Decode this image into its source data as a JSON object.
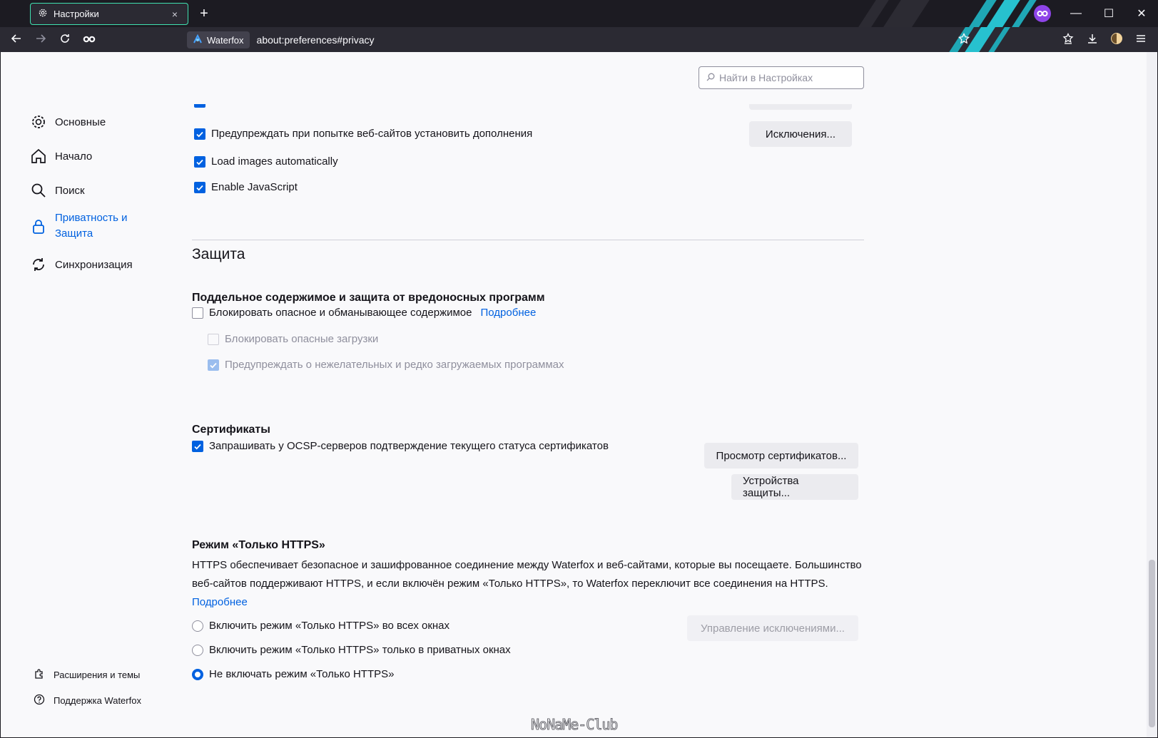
{
  "window": {
    "tab_title": "Настройки",
    "close_tab_symbol": "×",
    "new_tab_symbol": "+",
    "minimize_symbol": "—",
    "maximize_symbol": "☐",
    "close_symbol": "✕",
    "accent_color": "#3fe1b0"
  },
  "navbar": {
    "identity_label": "Waterfox",
    "url": "about:preferences#privacy"
  },
  "search": {
    "placeholder": "Найти в Настройках"
  },
  "sidebar": {
    "items": [
      {
        "label": "Основные",
        "icon": "gear-icon"
      },
      {
        "label": "Начало",
        "icon": "home-icon"
      },
      {
        "label": "Поиск",
        "icon": "search-icon"
      },
      {
        "label": "Приватность и Защита",
        "icon": "lock-icon",
        "selected": true
      },
      {
        "label": "Синхронизация",
        "icon": "sync-icon"
      }
    ],
    "footer": [
      {
        "label": "Расширения и темы",
        "icon": "puzzle-icon"
      },
      {
        "label": "Поддержка Waterfox",
        "icon": "help-icon"
      }
    ]
  },
  "permissions": {
    "warn_addons": "Предупреждать при попытке веб-сайтов установить дополнения",
    "exceptions_button": "Исключения...",
    "load_images": "Load images automatically",
    "enable_js": "Enable JavaScript"
  },
  "security": {
    "heading": "Защита",
    "deceptive_heading": "Поддельное содержимое и защита от вредоносных программ",
    "block_dangerous": "Блокировать опасное и обманывающее содержимое",
    "learn_more": "Подробнее",
    "block_downloads": "Блокировать опасные загрузки",
    "warn_unwanted": "Предупреждать о нежелательных и редко загружаемых программах"
  },
  "certificates": {
    "heading": "Сертификаты",
    "ocsp": "Запрашивать у OCSP-серверов подтверждение текущего статуса сертификатов",
    "view_button": "Просмотр сертификатов...",
    "devices_button": "Устройства защиты..."
  },
  "https_only": {
    "heading": "Режим «Только HTTPS»",
    "description": "HTTPS обеспечивает безопасное и зашифрованное соединение между Waterfox и веб-сайтами, которые вы посещаете. Большинство веб-сайтов поддерживают HTTPS, и если включён режим «Только HTTPS», то Waterfox переключит все соединения на HTTPS.",
    "learn_more": "Подробнее",
    "option_all": "Включить режим «Только HTTPS» во всех окнах",
    "option_private": "Включить режим «Только HTTPS» только в приватных окнах",
    "option_off": "Не включать режим «Только HTTPS»",
    "manage_button": "Управление исключениями..."
  },
  "watermark": "NoNaMe-Club"
}
